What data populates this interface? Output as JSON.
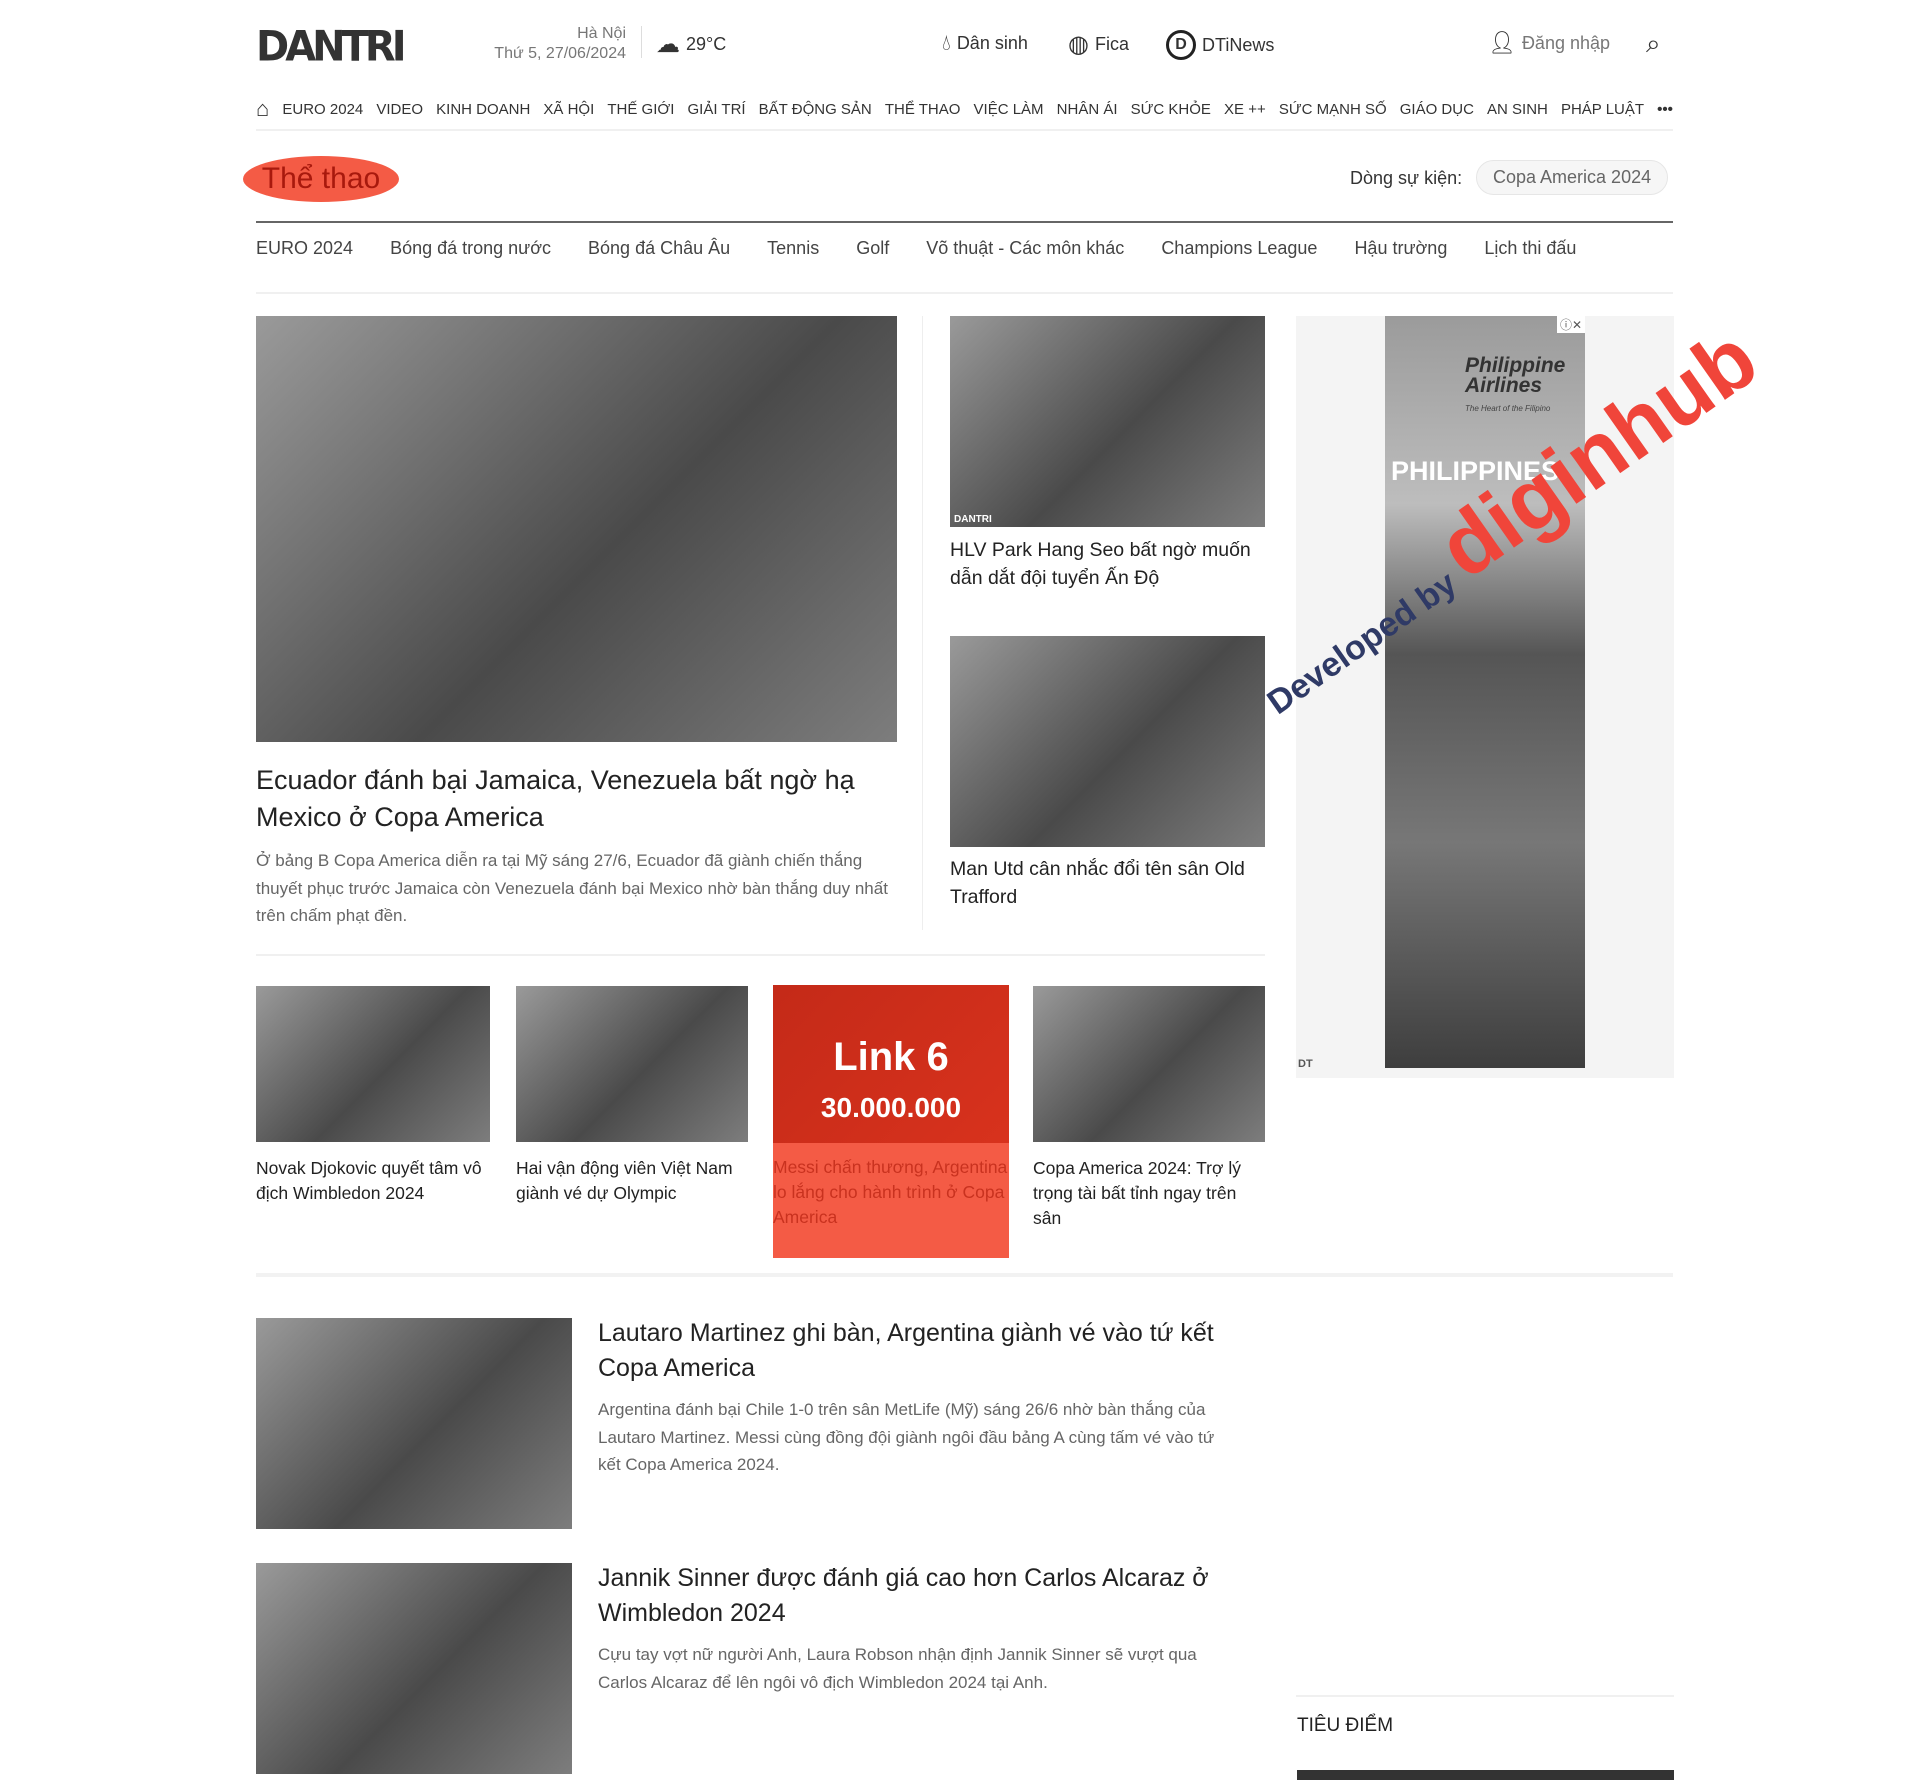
{
  "header": {
    "logo": "DANTRI",
    "city": "Hà Nội",
    "date": "Thứ 5, 27/06/2024",
    "temperature": "29°C",
    "links": [
      {
        "label": "Dân sinh",
        "icon": "drop-icon"
      },
      {
        "label": "Fica",
        "icon": "globe-icon"
      },
      {
        "label": "DTiNews",
        "icon": "d-logo-icon"
      }
    ],
    "login": "Đăng nhập"
  },
  "nav": {
    "items": [
      "EURO 2024",
      "VIDEO",
      "KINH DOANH",
      "XÃ HỘI",
      "THẾ GIỚI",
      "GIẢI TRÍ",
      "BẤT ĐỘNG SẢN",
      "THỂ THAO",
      "VIỆC LÀM",
      "NHÂN ÁI",
      "SỨC KHỎE",
      "XE ++",
      "SỨC MẠNH SỐ",
      "GIÁO DỤC",
      "AN SINH",
      "PHÁP LUẬT"
    ],
    "more": "•••"
  },
  "category": {
    "title": "Thể thao",
    "event_label": "Dòng sự kiện:",
    "event_tag": "Copa America 2024",
    "subnav": [
      "EURO 2024",
      "Bóng đá trong nước",
      "Bóng đá Châu Âu",
      "Tennis",
      "Golf",
      "Võ thuật - Các môn khác",
      "Champions League",
      "Hậu trường",
      "Lịch thi đấu"
    ]
  },
  "featured": {
    "title": "Ecuador đánh bại Jamaica, Venezuela bất ngờ hạ Mexico ở Copa America",
    "description": "Ở bảng B Copa America diễn ra tại Mỹ sáng 27/6, Ecuador đã giành chiến thắng thuyết phục trước Jamaica còn Venezuela đánh bại Mexico nhờ bàn thắng duy nhất trên chấm phạt đền."
  },
  "side_articles": [
    {
      "title": "HLV Park Hang Seo bất ngờ muốn dẫn dắt đội tuyển Ấn Độ",
      "watermark": "DANTRI"
    },
    {
      "title": "Man Utd cân nhắc đổi tên sân Old Trafford"
    }
  ],
  "grid_articles": [
    {
      "title": "Novak Djokovic quyết tâm vô địch Wimbledon 2024"
    },
    {
      "title": "Hai vận động viên Việt Nam giành vé dự Olympic"
    },
    {
      "title": "Messi chấn thương, Argentina lo lắng cho hành trình ở Copa America",
      "overlay_title": "Link 6",
      "overlay_price": "30.000.000"
    },
    {
      "title": "Copa America 2024: Trợ lý trọng tài bất tỉnh ngay trên sân"
    }
  ],
  "list_articles": [
    {
      "title": "Lautaro Martinez ghi bàn, Argentina giành vé vào tứ kết Copa America",
      "description": "Argentina đánh bại Chile 1-0 trên sân MetLife (Mỹ) sáng 26/6 nhờ bàn thắng của Lautaro Martinez. Messi cùng đồng đội giành ngôi đầu bảng A cùng tấm vé vào tứ kết Copa America 2024."
    },
    {
      "title": "Jannik Sinner được đánh giá cao hơn Carlos Alcaraz ở Wimbledon 2024",
      "description": "Cựu tay vợt nữ người Anh, Laura Robson nhận định Jannik Sinner sẽ vượt qua Carlos Alcaraz để lên ngôi vô địch Wimbledon 2024 tại Anh."
    }
  ],
  "ad": {
    "brand": "Philippine Airlines",
    "tagline": "The Heart of the Filipino",
    "headline": "PHILIPPINES",
    "badge": "DT"
  },
  "sidebar": {
    "focus_title": "TIÊU ĐIỂM"
  },
  "watermark": {
    "prefix": "Developed by",
    "brand": "diginhub"
  },
  "colors": {
    "accent": "#f45b45",
    "text": "#222222"
  }
}
